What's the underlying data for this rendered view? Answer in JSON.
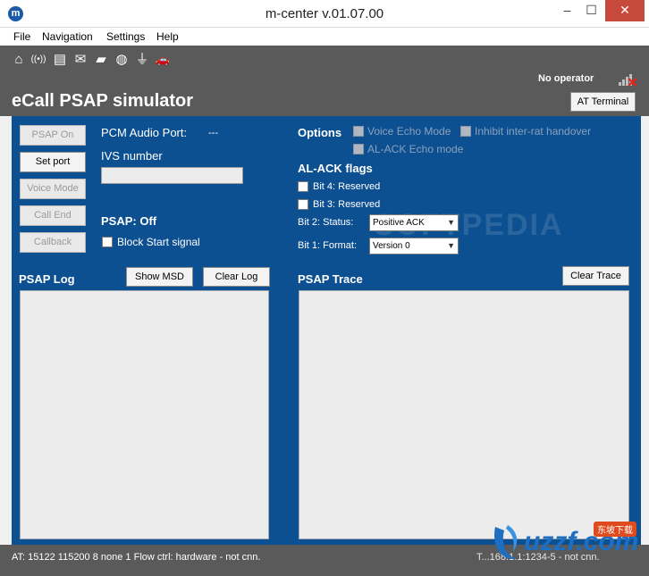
{
  "window": {
    "title": "m-center v.01.07.00",
    "app_icon": "m",
    "minimize": "–",
    "maximize": "☐",
    "close": "✕"
  },
  "menu": {
    "items": [
      "File",
      "Navigation",
      "Settings",
      "Help"
    ]
  },
  "toolbar": {
    "icons": [
      "home-icon",
      "wireless-icon",
      "sim-card-icon",
      "mail-icon",
      "folder-icon",
      "globe-icon",
      "antenna-icon",
      "car-icon"
    ],
    "glyphs": [
      "⌂",
      "((•))",
      "▤",
      "✉",
      "▰",
      "◍",
      "⏚",
      "🚗"
    ],
    "operator": "No operator"
  },
  "header": {
    "title": "eCall PSAP simulator",
    "at_terminal": "AT Terminal"
  },
  "left_buttons": [
    "PSAP On",
    "Set port",
    "Voice Mode",
    "Call End",
    "Callback"
  ],
  "pcm": {
    "label": "PCM Audio Port:",
    "value": "---"
  },
  "ivs": {
    "label": "IVS number",
    "value": ""
  },
  "psap": {
    "status": "PSAP: Off",
    "block_start": "Block Start signal"
  },
  "options": {
    "title": "Options",
    "voice_echo": "Voice Echo Mode",
    "inhibit": "Inhibit inter-rat handover",
    "al_ack_echo": "AL-ACK Echo mode"
  },
  "al_ack": {
    "title": "AL-ACK flags",
    "bit4": "Bit 4: Reserved",
    "bit3": "Bit 3: Reserved",
    "bit2_label": "Bit 2: Status:",
    "bit2_value": "Positive ACK",
    "bit1_label": "Bit 1: Format:",
    "bit1_value": "Version 0"
  },
  "psap_log": {
    "title": "PSAP Log",
    "show_msd": "Show MSD",
    "clear_log": "Clear Log"
  },
  "psap_trace": {
    "title": "PSAP Trace",
    "clear_trace": "Clear Trace"
  },
  "watermark": "SOFTPEDIA",
  "status": {
    "left": "AT: 15122 115200 8 none 1 Flow ctrl: hardware - not cnn.",
    "right": "T...168.1.1:1234-5 - not cnn."
  },
  "logo": {
    "text": "uzzf.com",
    "badge": "东坡下载"
  },
  "colors": {
    "panel": "#0d5091",
    "chrome": "#5a5a5a",
    "close": "#c74a3d"
  }
}
